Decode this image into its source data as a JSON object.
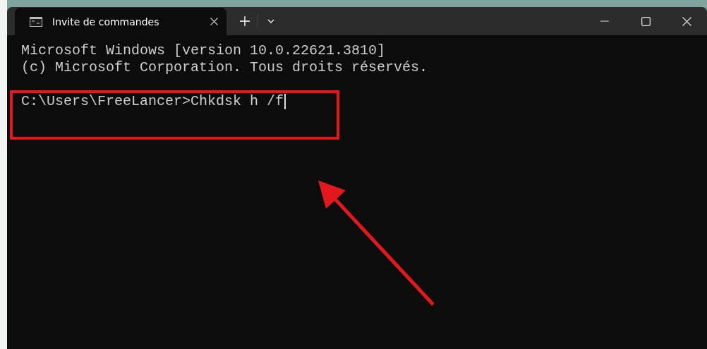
{
  "window": {
    "tabs": [
      {
        "title": "Invite de commandes",
        "selected": true
      }
    ]
  },
  "terminal": {
    "lines": [
      {
        "kind": "output",
        "text": "Microsoft Windows [version 10.0.22621.3810]"
      },
      {
        "kind": "output",
        "text": "(c) Microsoft Corporation. Tous droits réservés."
      },
      {
        "kind": "prompt",
        "text": "C:\\Users\\FreeLancer>Chkdsk h /f"
      }
    ]
  }
}
